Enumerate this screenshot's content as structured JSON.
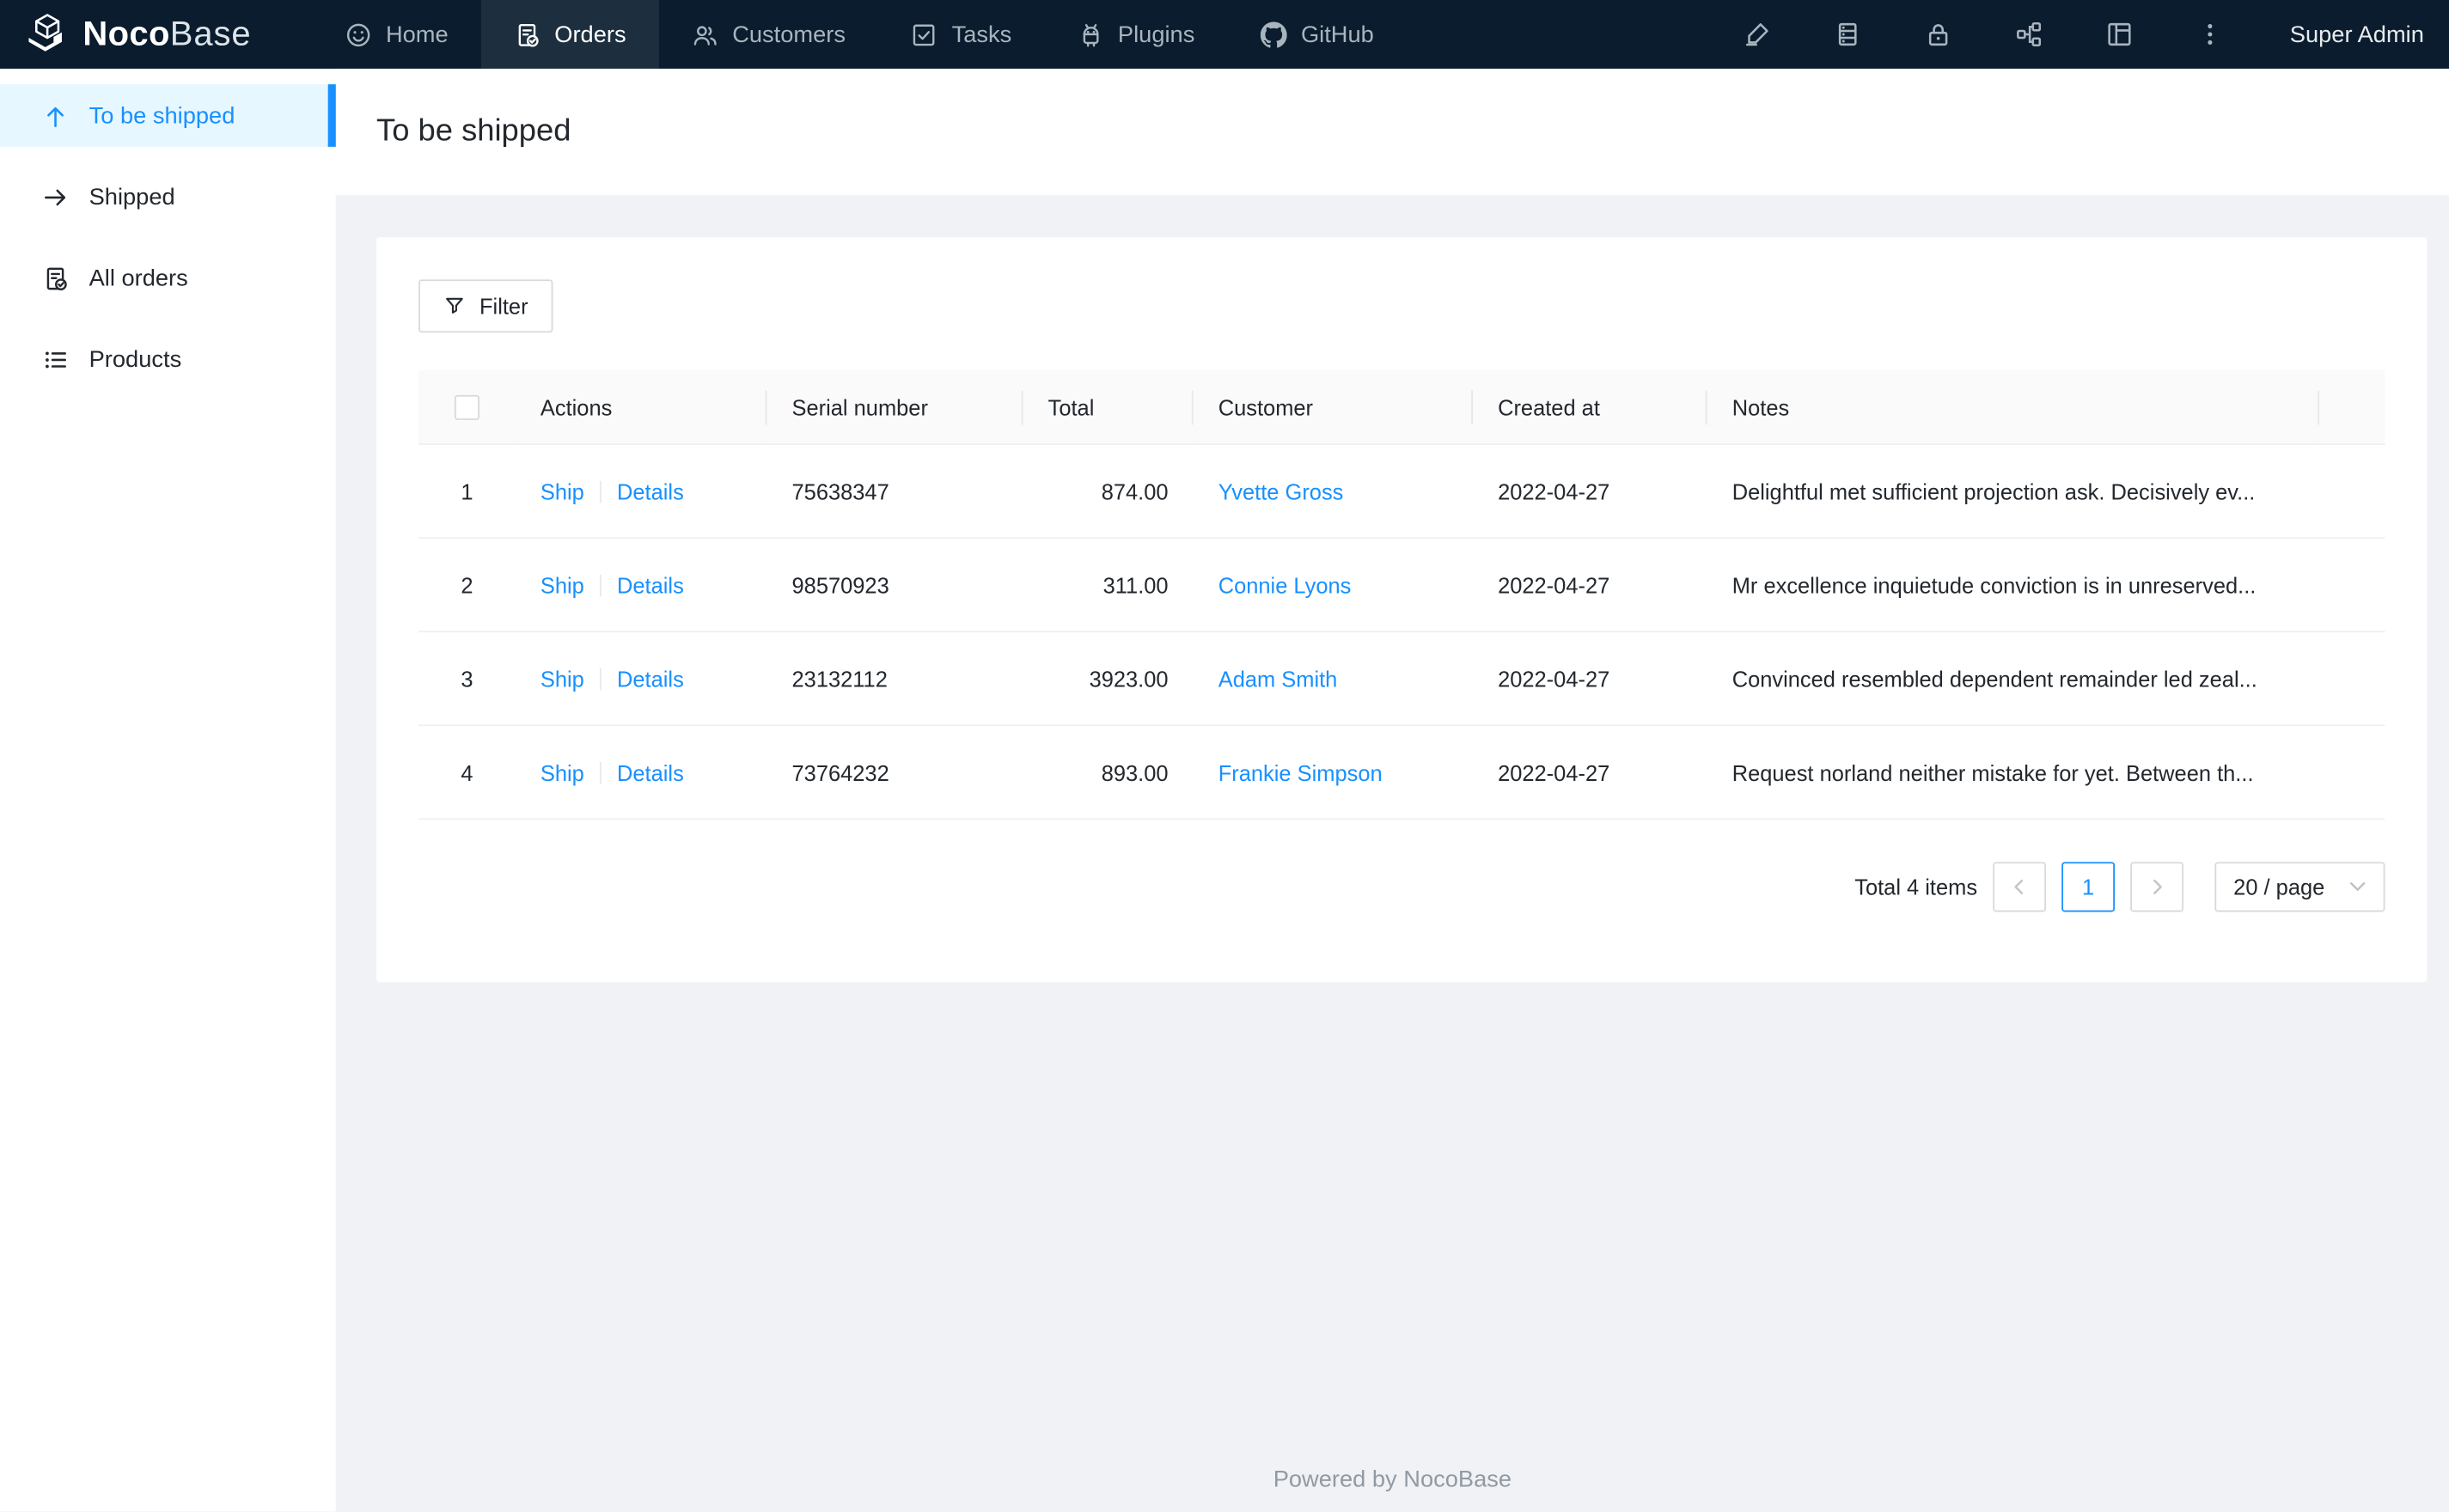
{
  "topbar": {
    "logo": {
      "part1": "Noco",
      "part2": "Base"
    },
    "nav": [
      {
        "label": "Home",
        "icon": "smile-icon",
        "active": false
      },
      {
        "label": "Orders",
        "icon": "file-done-icon",
        "active": true
      },
      {
        "label": "Customers",
        "icon": "team-icon",
        "active": false
      },
      {
        "label": "Tasks",
        "icon": "check-square-icon",
        "active": false
      },
      {
        "label": "Plugins",
        "icon": "robot-icon",
        "active": false
      },
      {
        "label": "GitHub",
        "icon": "github-icon",
        "active": false
      }
    ],
    "tools": [
      "highlighter-icon",
      "database-icon",
      "lock-icon",
      "partition-icon",
      "layout-icon",
      "ellipsis-vertical-icon"
    ],
    "user": "Super Admin"
  },
  "sidebar": {
    "items": [
      {
        "label": "To be shipped",
        "icon": "arrow-up-icon",
        "active": true
      },
      {
        "label": "Shipped",
        "icon": "arrow-right-icon",
        "active": false
      },
      {
        "label": "All orders",
        "icon": "file-done-icon",
        "active": false
      },
      {
        "label": "Products",
        "icon": "unordered-list-icon",
        "active": false
      }
    ]
  },
  "page": {
    "title": "To be shipped"
  },
  "toolbar": {
    "filter_label": "Filter"
  },
  "table": {
    "columns": [
      "Actions",
      "Serial number",
      "Total",
      "Customer",
      "Created at",
      "Notes"
    ],
    "rows": [
      {
        "index": "1",
        "ship": "Ship",
        "details": "Details",
        "serial": "75638347",
        "total": "874.00",
        "customer": "Yvette Gross",
        "created_at": "2022-04-27",
        "notes": "Delightful met sufficient projection ask. Decisively ev..."
      },
      {
        "index": "2",
        "ship": "Ship",
        "details": "Details",
        "serial": "98570923",
        "total": "311.00",
        "customer": "Connie Lyons",
        "created_at": "2022-04-27",
        "notes": "Mr excellence inquietude conviction is in unreserved..."
      },
      {
        "index": "3",
        "ship": "Ship",
        "details": "Details",
        "serial": "23132112",
        "total": "3923.00",
        "customer": "Adam Smith",
        "created_at": "2022-04-27",
        "notes": "Convinced resembled dependent remainder led zeal..."
      },
      {
        "index": "4",
        "ship": "Ship",
        "details": "Details",
        "serial": "73764232",
        "total": "893.00",
        "customer": "Frankie Simpson",
        "created_at": "2022-04-27",
        "notes": "Request norland neither mistake for yet. Between th..."
      }
    ]
  },
  "pagination": {
    "total_label": "Total 4 items",
    "current_page": "1",
    "page_size_label": "20 / page"
  },
  "footer": {
    "text": "Powered by NocoBase"
  },
  "colors": {
    "accent": "#1890ff",
    "topbar_bg": "#0a1c2e",
    "topbar_active_bg": "#1d2f3f",
    "sidebar_active_bg": "#e6f7ff",
    "content_bg": "#f0f2f5",
    "table_header_bg": "#fafafa",
    "row_border": "#f0f0f0",
    "button_border": "#d9d9d9"
  }
}
